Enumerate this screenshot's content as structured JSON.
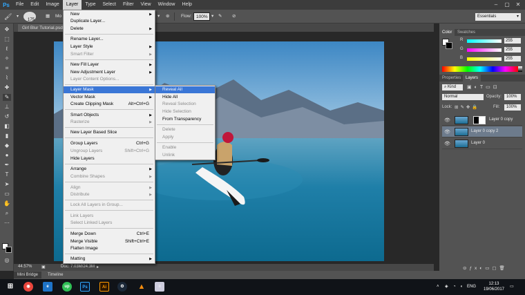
{
  "app": {
    "logo": "Ps"
  },
  "menubar": {
    "items": [
      "File",
      "Edit",
      "Image",
      "Layer",
      "Type",
      "Select",
      "Filter",
      "View",
      "Window",
      "Help"
    ],
    "active": "Layer"
  },
  "options": {
    "brush_size": "175",
    "mode_prefix": "Mo",
    "flow_label": "Flow:",
    "flow_value": "100%",
    "workspace": "Essentials"
  },
  "document": {
    "tab_title": "Girl Blur Tutorial.psd",
    "zoom": "44.57%",
    "doc_info": "Doc: 7.03M/24.3M"
  },
  "bottom_tabs": [
    "Mini Bridge",
    "Timeline"
  ],
  "layer_menu": {
    "items": [
      {
        "label": "New",
        "arrow": true
      },
      {
        "label": "Duplicate Layer..."
      },
      {
        "label": "Delete",
        "arrow": true
      },
      {
        "label": "Rename Layer..."
      },
      {
        "label": "Layer Style",
        "arrow": true
      },
      {
        "label": "Smart Filter",
        "arrow": true,
        "disabled": true
      },
      {
        "label": "New Fill Layer",
        "arrow": true
      },
      {
        "label": "New Adjustment Layer",
        "arrow": true
      },
      {
        "label": "Layer Content Options...",
        "disabled": true
      },
      {
        "label": "Layer Mask",
        "arrow": true,
        "highlighted": true
      },
      {
        "label": "Vector Mask",
        "arrow": true
      },
      {
        "label": "Create Clipping Mask",
        "shortcut": "Alt+Ctrl+G"
      },
      {
        "label": "Smart Objects",
        "arrow": true
      },
      {
        "label": "Rasterize",
        "arrow": true,
        "disabled": true
      },
      {
        "label": "New Layer Based Slice"
      },
      {
        "label": "Group Layers",
        "shortcut": "Ctrl+G"
      },
      {
        "label": "Ungroup Layers",
        "shortcut": "Shift+Ctrl+G",
        "disabled": true
      },
      {
        "label": "Hide Layers"
      },
      {
        "label": "Arrange",
        "arrow": true
      },
      {
        "label": "Combine Shapes",
        "arrow": true,
        "disabled": true
      },
      {
        "label": "Align",
        "arrow": true,
        "disabled": true
      },
      {
        "label": "Distribute",
        "arrow": true,
        "disabled": true
      },
      {
        "label": "Lock All Layers in Group...",
        "disabled": true
      },
      {
        "label": "Link Layers",
        "disabled": true
      },
      {
        "label": "Select Linked Layers",
        "disabled": true
      },
      {
        "label": "Merge Down",
        "shortcut": "Ctrl+E"
      },
      {
        "label": "Merge Visible",
        "shortcut": "Shift+Ctrl+E"
      },
      {
        "label": "Flatten Image"
      },
      {
        "label": "Matting",
        "arrow": true
      }
    ]
  },
  "layer_mask_submenu": {
    "items": [
      {
        "label": "Reveal All",
        "highlighted": true
      },
      {
        "label": "Hide All"
      },
      {
        "label": "Reveal Selection",
        "disabled": true
      },
      {
        "label": "Hide Selection",
        "disabled": true
      },
      {
        "label": "From Transparency"
      },
      {
        "label": "Delete",
        "disabled": true
      },
      {
        "label": "Apply",
        "disabled": true
      },
      {
        "label": "Enable",
        "disabled": true
      },
      {
        "label": "Unlink",
        "disabled": true
      }
    ]
  },
  "color_panel": {
    "tabs": [
      "Color",
      "Swatches"
    ],
    "r_label": "R",
    "r_value": "255",
    "g_label": "G",
    "g_value": "255",
    "b_label": "B",
    "b_value": "255"
  },
  "layers_panel": {
    "tabs": [
      "Properties",
      "Layers"
    ],
    "filter_kind": "Kind",
    "blend_mode": "Normal",
    "opacity_label": "Opacity:",
    "opacity_value": "100%",
    "lock_label": "Lock:",
    "fill_label": "Fill:",
    "fill_value": "100%",
    "layers": [
      {
        "name": "Layer 0 copy",
        "mask": true,
        "selected": false
      },
      {
        "name": "Layer 0 copy 2",
        "mask": false,
        "selected": true
      },
      {
        "name": "Layer 0",
        "mask": false,
        "selected": false
      }
    ]
  },
  "taskbar": {
    "time": "12:13",
    "date": "19/06/2017",
    "lang": "ENG"
  },
  "colors": {
    "menu_highlight": "#3a76d6",
    "layer_selected": "#6d7b8c",
    "ps_blue": "#31a8ff"
  }
}
